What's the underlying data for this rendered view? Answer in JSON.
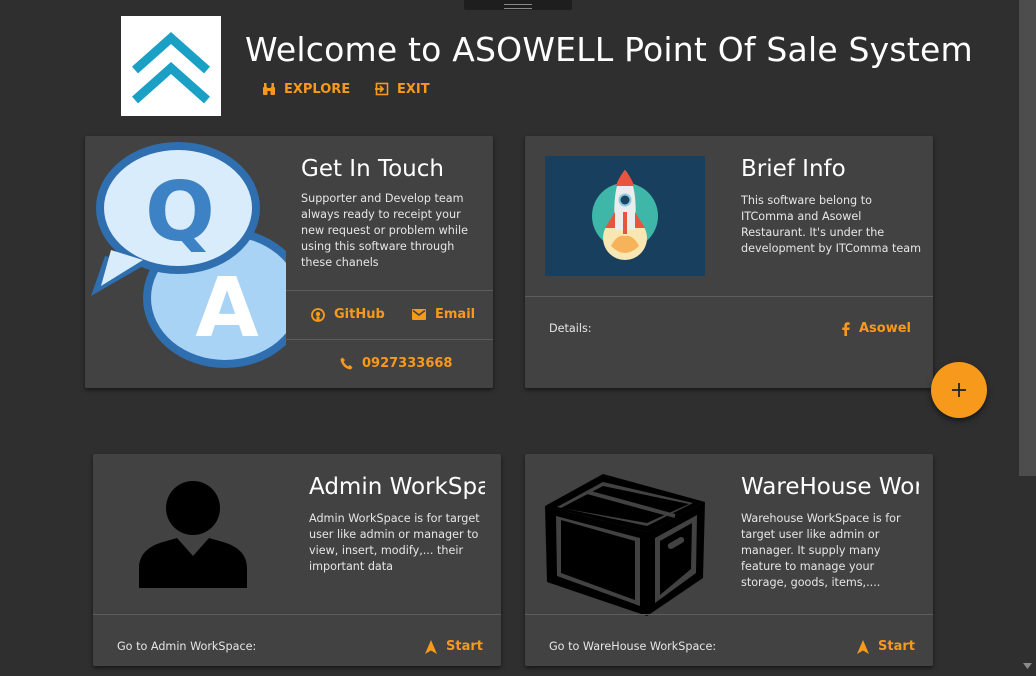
{
  "header": {
    "title": "Welcome to ASOWELL Point Of Sale System",
    "explore_label": "EXPLORE",
    "exit_label": "EXIT"
  },
  "cards": {
    "contact": {
      "title": "Get In Touch",
      "text": "Supporter and Develop team always ready to receipt your new request or problem while using this software through these chanels",
      "github_label": "GitHub",
      "email_label": "Email",
      "phone_label": "0927333668"
    },
    "info": {
      "title": "Brief Info",
      "text": "This software belong to ITComma and Asowel Restaurant. It's under the development by ITComma team",
      "details_label": "Details:",
      "facebook_label": "Asowel"
    },
    "admin": {
      "title": "Admin WorkSpace",
      "text": "Admin WorkSpace is for target user like admin or manager to view, insert, modify,... their important data",
      "footer_label": "Go to Admin WorkSpace:",
      "start_label": "Start"
    },
    "warehouse": {
      "title": "WareHouse WorkSpace",
      "text": "Warehouse WorkSpace is for target user like admin or manager. It supply many feature to manage your storage, goods, items,....",
      "footer_label": "Go to WareHouse WorkSpace:",
      "start_label": "Start"
    }
  },
  "colors": {
    "background": "#2f2f2f",
    "card": "#424242",
    "accent": "#f79a1c",
    "logo": "#1aa0c4"
  },
  "icons": {
    "explore": "binoculars-icon",
    "exit": "exit-icon",
    "github": "github-icon",
    "email": "email-icon",
    "phone": "phone-icon",
    "facebook": "facebook-icon",
    "start": "navigation-arrow-icon",
    "fab": "plus-icon"
  }
}
